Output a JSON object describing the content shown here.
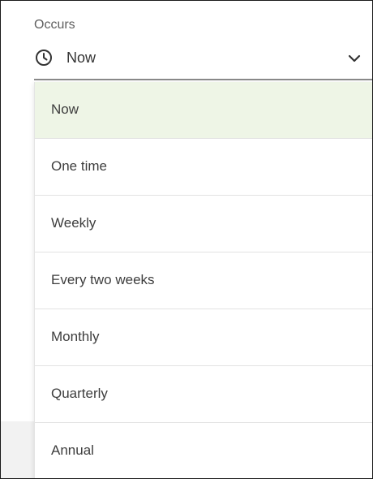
{
  "field": {
    "label": "Occurs",
    "value": "Now",
    "value_icon": "clock-icon",
    "toggle_icon": "chevron-down-icon"
  },
  "menu": {
    "items": [
      {
        "label": "Now",
        "selected": true
      },
      {
        "label": "One time",
        "selected": false
      },
      {
        "label": "Weekly",
        "selected": false
      },
      {
        "label": "Every two weeks",
        "selected": false
      },
      {
        "label": "Monthly",
        "selected": false
      },
      {
        "label": "Quarterly",
        "selected": false
      },
      {
        "label": "Annual",
        "selected": false
      }
    ]
  },
  "colors": {
    "selected_bg": "#eef5e6",
    "divider": "#e2e2e2"
  }
}
